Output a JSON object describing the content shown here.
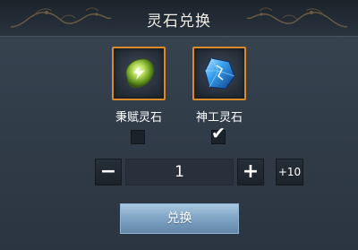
{
  "header": {
    "title": "灵石兑换"
  },
  "items": [
    {
      "name": "秉赋灵石",
      "icon": "green-spirit-stone-icon",
      "checked": false
    },
    {
      "name": "神工灵石",
      "icon": "blue-spirit-stone-icon",
      "checked": true
    }
  ],
  "stepper": {
    "minus_label": "−",
    "quantity": "1",
    "plus_label": "+",
    "plus10_label": "+10"
  },
  "exchange_button": {
    "label": "兑换"
  },
  "colors": {
    "frame_border": "#d98a2b",
    "button_blue": "#7ea2c3",
    "background": "#323d4a"
  }
}
